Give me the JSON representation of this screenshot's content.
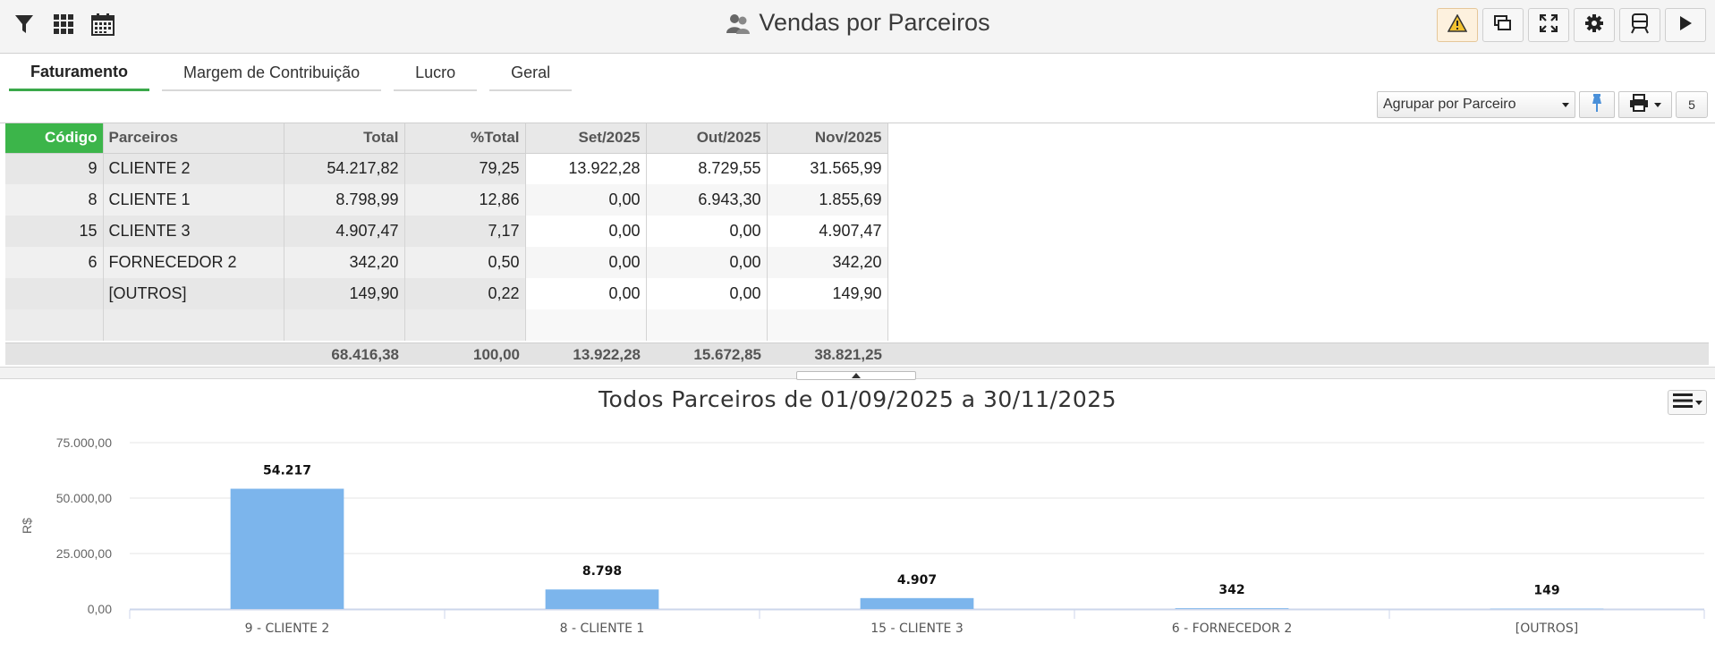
{
  "header": {
    "title": "Vendas por Parceiros",
    "left_icons": [
      "filter-icon",
      "grid-icon",
      "calendar-icon"
    ],
    "right_icons": [
      "warning-icon",
      "windows-icon",
      "fullscreen-icon",
      "gear-icon",
      "bus-icon",
      "play-icon"
    ]
  },
  "tabs": [
    {
      "label": "Faturamento",
      "active": true
    },
    {
      "label": "Margem de Contribuição",
      "active": false
    },
    {
      "label": "Lucro",
      "active": false
    },
    {
      "label": "Geral",
      "active": false
    }
  ],
  "controls": {
    "group_by": "Agrupar por Parceiro",
    "count": "5"
  },
  "table": {
    "headers": [
      "Código",
      "Parceiros",
      "Total",
      "%Total",
      "Set/2025",
      "Out/2025",
      "Nov/2025"
    ],
    "rows": [
      [
        "9",
        "CLIENTE 2",
        "54.217,82",
        "79,25",
        "13.922,28",
        "8.729,55",
        "31.565,99"
      ],
      [
        "8",
        "CLIENTE 1",
        "8.798,99",
        "12,86",
        "0,00",
        "6.943,30",
        "1.855,69"
      ],
      [
        "15",
        "CLIENTE 3",
        "4.907,47",
        "7,17",
        "0,00",
        "0,00",
        "4.907,47"
      ],
      [
        "6",
        "FORNECEDOR 2",
        "342,20",
        "0,50",
        "0,00",
        "0,00",
        "342,20"
      ],
      [
        "",
        "[OUTROS]",
        "149,90",
        "0,22",
        "0,00",
        "0,00",
        "149,90"
      ]
    ],
    "totals": [
      "68.416,38",
      "100,00",
      "13.922,28",
      "15.672,85",
      "38.821,25"
    ]
  },
  "chart": {
    "title": "Todos Parceiros de 01/09/2025 a 30/11/2025",
    "bar_color": "#7cb5ec"
  },
  "chart_data": {
    "type": "bar",
    "title": "Todos Parceiros de 01/09/2025 a 30/11/2025",
    "xlabel": "",
    "ylabel": "R$",
    "categories": [
      "9 - CLIENTE 2",
      "8 - CLIENTE 1",
      "15 - CLIENTE 3",
      "6 - FORNECEDOR 2",
      "[OUTROS]"
    ],
    "values": [
      54217.82,
      8798.99,
      4907.47,
      342.2,
      149.9
    ],
    "data_labels": [
      "54.217",
      "8.798",
      "4.907",
      "342",
      "149"
    ],
    "yticks": [
      "0,00",
      "25.000,00",
      "50.000,00",
      "75.000,00"
    ],
    "ylim": [
      0,
      75000
    ],
    "grid": true
  }
}
